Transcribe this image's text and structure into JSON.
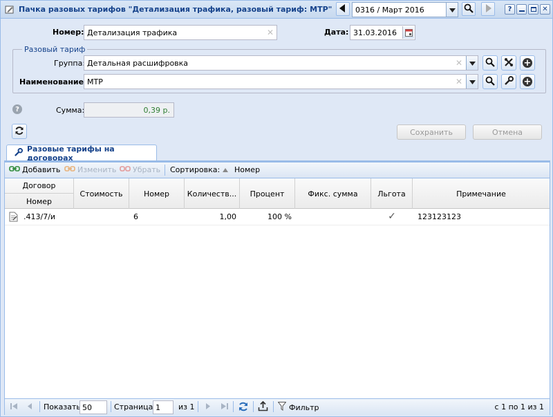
{
  "window": {
    "title": "Пачка разовых тарифов \"Детализация трафика, разовый тариф: МТР\"",
    "period": "0316 / Март 2016"
  },
  "form": {
    "number_label": "Номер:",
    "number_value": "Детализация трафика",
    "date_label": "Дата:",
    "date_value": "31.03.2016",
    "fieldset_legend": "Разовый тариф",
    "group_label": "Группа:",
    "group_value": "Детальная расшифровка",
    "name_label": "Наименование:",
    "name_value": "МТР",
    "sum_label": "Сумма:",
    "sum_value": "0,39 р."
  },
  "buttons": {
    "save": "Сохранить",
    "cancel": "Отмена"
  },
  "tab": {
    "label": "Разовые тарифы на договорах"
  },
  "toolbar": {
    "add": "Добавить",
    "edit": "Изменить",
    "remove": "Убрать",
    "sort_label": "Сортировка:",
    "sort_field": "Номер"
  },
  "grid": {
    "columns": {
      "contract": "Договор",
      "number_sub": "Номер",
      "cost": "Стоимость",
      "number": "Номер",
      "quantity": "Количеств...",
      "percent": "Процент",
      "fixed_sum": "Фикс. сумма",
      "benefit": "Льгота",
      "note": "Примечание"
    },
    "rows": [
      {
        "contract": ".413/7/и",
        "cost": "",
        "number": "6",
        "quantity": "1,00",
        "percent": "100 %",
        "fixed_sum": "",
        "benefit": "✓",
        "note": "123123123"
      }
    ]
  },
  "pager": {
    "show_label": "Показать",
    "page_size": "50",
    "page_label": "Страница",
    "page": "1",
    "of_label": "из 1",
    "filter_label": "Фильтр",
    "summary": "с 1 по 1 из 1"
  },
  "colors": {
    "accent": "#15428b",
    "border": "#99bbe8",
    "background": "#dfe8f6",
    "sum_value_color": "#2e7d32"
  }
}
